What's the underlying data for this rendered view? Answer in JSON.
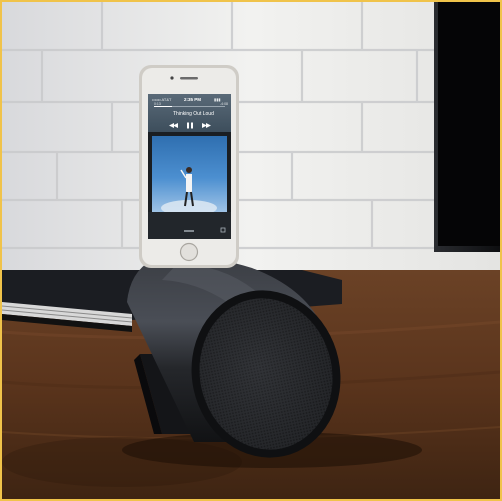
{
  "scene": {
    "subject": "iphone-docked-on-cylindrical-speaker",
    "colors": {
      "frame": "#f0c34a",
      "brick_wall": "#e8e8e6",
      "desk": "#5a3520",
      "speaker": "#2a2c30",
      "phone_silver": "#d9d6d0"
    }
  },
  "phone_screen": {
    "carrier": "•••oo AT&T",
    "time": "2:35 PM",
    "battery": "▮▮▮",
    "elapsed": "0:13",
    "remaining": "-4:08",
    "song_title": "Thinking Out Loud"
  },
  "icons": {
    "rewind": "rewind-icon",
    "pause": "pause-icon",
    "forward": "fast-forward-icon",
    "share": "share-icon"
  }
}
